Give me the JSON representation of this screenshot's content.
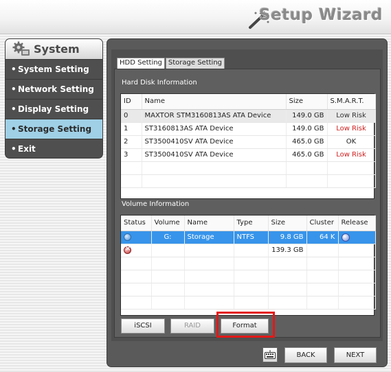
{
  "header": {
    "title": "Setup Wizard",
    "icon": "magic-wand-icon"
  },
  "sidebar": {
    "title": "System",
    "icon": "gear-icon",
    "items": [
      {
        "label": "System Setting",
        "active": false
      },
      {
        "label": "Network Setting",
        "active": false
      },
      {
        "label": "Display Setting",
        "active": false
      },
      {
        "label": "Storage Setting",
        "active": true
      },
      {
        "label": "Exit",
        "active": false
      }
    ]
  },
  "tabs": [
    {
      "label": "HDD Setting",
      "active": true
    },
    {
      "label": "Storage Setting",
      "active": false
    }
  ],
  "hdd": {
    "section_title": "Hard Disk Information",
    "columns": [
      "ID",
      "Name",
      "Size",
      "S.M.A.R.T."
    ],
    "rows": [
      {
        "id": "0",
        "name": "MAXTOR STM3160813AS ATA Device",
        "size": "149.0 GB",
        "smart": "Low Risk"
      },
      {
        "id": "1",
        "name": "ST3160813AS ATA Device",
        "size": "149.0 GB",
        "smart": "Low Risk"
      },
      {
        "id": "2",
        "name": "ST3500410SV ATA Device",
        "size": "465.0 GB",
        "smart": "OK"
      },
      {
        "id": "3",
        "name": "ST3500410SV ATA Device",
        "size": "465.0 GB",
        "smart": "Low Risk"
      }
    ]
  },
  "volume": {
    "section_title": "Volume Information",
    "columns": [
      "Status",
      "Volume",
      "Name",
      "Type",
      "Size",
      "Cluster",
      "Release"
    ],
    "rows": [
      {
        "status": "ok-icon",
        "volume": "G:",
        "name": "Storage",
        "type": "NTFS",
        "size": "9.8 GB",
        "cluster": "64 K",
        "release": "release-icon"
      },
      {
        "status": "error-icon",
        "volume": "",
        "name": "",
        "type": "",
        "size": "139.3 GB",
        "cluster": "",
        "release": ""
      }
    ]
  },
  "actions": {
    "iscsi": "iSCSI",
    "raid": "RAID",
    "format": "Format"
  },
  "nav": {
    "back": "BACK",
    "next": "NEXT",
    "keyboard_icon": "keyboard-icon"
  },
  "colors": {
    "accent_selected": "#3794ea",
    "active_menu": "#9fd0e6",
    "risk_text": "#d02020",
    "highlight_frame": "#e31818"
  }
}
